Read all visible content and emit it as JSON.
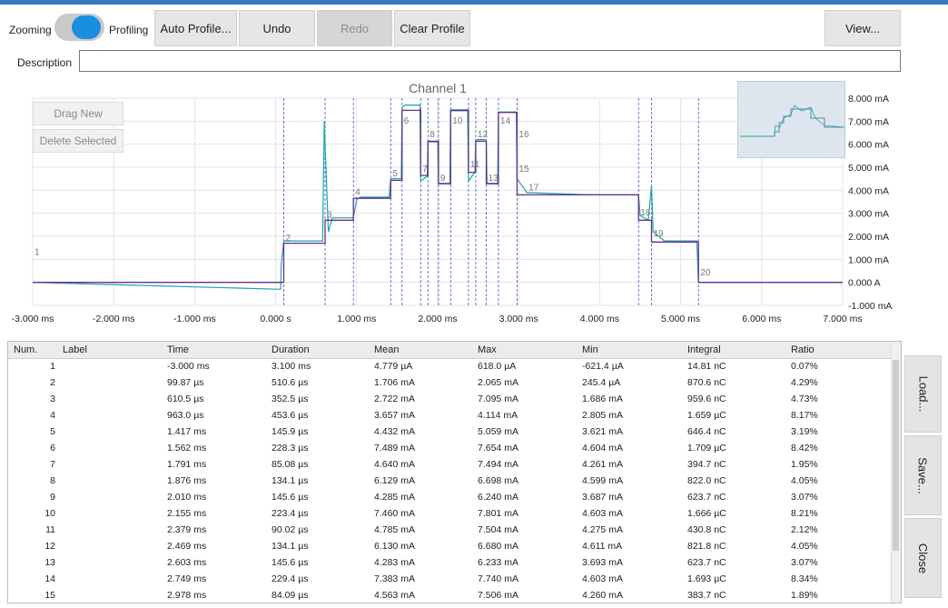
{
  "toolbar": {
    "zooming_label": "Zooming",
    "profiling_label": "Profiling",
    "auto_profile": "Auto Profile...",
    "undo": "Undo",
    "redo": "Redo",
    "clear_profile": "Clear Profile",
    "view": "View..."
  },
  "description": {
    "label": "Description",
    "value": ""
  },
  "chart_buttons": {
    "drag_new": "Drag New",
    "delete_selected": "Delete Selected"
  },
  "chart_data": {
    "type": "line",
    "title": "Channel 1",
    "x_unit": "ms",
    "xlim": [
      -3.0,
      7.0
    ],
    "ylim": [
      -1.0,
      8.0
    ],
    "x_ticks": [
      "-3.000 ms",
      "-2.000 ms",
      "-1.000 ms",
      "0.000 s",
      "1.000 ms",
      "2.000 ms",
      "3.000 ms",
      "4.000 ms",
      "5.000 ms",
      "6.000 ms",
      "7.000 ms"
    ],
    "y_ticks": [
      "8.000 mA",
      "7.000 mA",
      "6.000 mA",
      "5.000 mA",
      "4.000 mA",
      "3.000 mA",
      "2.000 mA",
      "1.000 mA",
      "0.000 A",
      "-1.000 mA"
    ],
    "grid": true,
    "series": [
      {
        "color": "#1aa6a6",
        "x": [
          -3.0,
          0.06,
          0.07,
          0.1,
          0.58,
          0.6,
          0.65,
          0.7,
          0.96,
          1.0,
          1.05,
          1.4,
          1.42,
          1.55,
          1.56,
          1.6,
          1.78,
          1.79,
          1.87,
          1.88,
          2.0,
          2.01,
          2.15,
          2.16,
          2.37,
          2.38,
          2.46,
          2.47,
          2.6,
          2.61,
          2.74,
          2.75,
          2.97,
          2.98,
          3.1,
          3.9,
          4.48,
          4.5,
          4.6,
          4.64,
          4.66,
          4.8,
          5.2,
          5.22,
          7.0
        ],
        "y": [
          0.0,
          -0.3,
          0.8,
          1.8,
          1.8,
          7.0,
          2.2,
          2.8,
          2.8,
          3.6,
          3.7,
          3.7,
          4.5,
          4.5,
          7.6,
          7.7,
          7.7,
          4.4,
          4.6,
          6.1,
          6.1,
          4.3,
          4.3,
          7.5,
          7.5,
          4.4,
          4.8,
          6.2,
          6.2,
          4.3,
          4.3,
          7.4,
          7.4,
          4.5,
          3.9,
          3.8,
          3.8,
          2.9,
          2.7,
          4.2,
          2.2,
          1.8,
          1.8,
          0.0,
          0.0
        ]
      },
      {
        "color": "#6a2d8c",
        "x": [
          -3.0,
          0.1,
          0.1,
          0.61,
          0.61,
          0.96,
          0.96,
          1.42,
          1.42,
          1.56,
          1.56,
          1.79,
          1.79,
          1.88,
          1.88,
          2.01,
          2.01,
          2.16,
          2.16,
          2.38,
          2.38,
          2.47,
          2.47,
          2.6,
          2.6,
          2.75,
          2.75,
          2.98,
          2.98,
          4.48,
          4.48,
          4.64,
          4.64,
          5.22,
          5.22,
          7.0
        ],
        "y": [
          0.0,
          0.0,
          1.7,
          1.7,
          2.7,
          2.7,
          3.65,
          3.65,
          4.43,
          4.43,
          7.47,
          7.47,
          4.64,
          4.64,
          6.13,
          6.13,
          4.28,
          4.28,
          7.46,
          7.46,
          4.78,
          4.78,
          6.13,
          6.13,
          4.28,
          4.28,
          7.38,
          7.38,
          3.8,
          3.8,
          2.7,
          2.7,
          1.75,
          1.75,
          0.0,
          0.0
        ]
      }
    ],
    "segment_markers": [
      {
        "n": "1",
        "x": -3.0,
        "y": 1.2
      },
      {
        "n": "2",
        "x": 0.1,
        "y": 1.8
      },
      {
        "n": "3",
        "x": 0.61,
        "y": 2.8
      },
      {
        "n": "4",
        "x": 0.96,
        "y": 3.8
      },
      {
        "n": "5",
        "x": 1.42,
        "y": 4.6
      },
      {
        "n": "6",
        "x": 1.56,
        "y": 6.9
      },
      {
        "n": "7",
        "x": 1.79,
        "y": 4.8
      },
      {
        "n": "8",
        "x": 1.88,
        "y": 6.3
      },
      {
        "n": "9",
        "x": 2.01,
        "y": 4.4
      },
      {
        "n": "10",
        "x": 2.16,
        "y": 6.9
      },
      {
        "n": "11",
        "x": 2.38,
        "y": 5.0
      },
      {
        "n": "12",
        "x": 2.47,
        "y": 6.3
      },
      {
        "n": "13",
        "x": 2.6,
        "y": 4.4
      },
      {
        "n": "14",
        "x": 2.75,
        "y": 6.9
      },
      {
        "n": "15",
        "x": 2.98,
        "y": 4.8
      },
      {
        "n": "16",
        "x": 2.98,
        "y": 6.3
      },
      {
        "n": "17",
        "x": 3.1,
        "y": 4.0
      },
      {
        "n": "18",
        "x": 4.48,
        "y": 2.9
      },
      {
        "n": "19",
        "x": 4.64,
        "y": 2.0
      },
      {
        "n": "20",
        "x": 5.22,
        "y": 0.3
      }
    ],
    "dividers": [
      0.1,
      0.61,
      0.96,
      1.42,
      1.56,
      1.79,
      1.88,
      2.01,
      2.16,
      2.38,
      2.47,
      2.6,
      2.75,
      2.98,
      4.48,
      4.64,
      5.22
    ]
  },
  "table": {
    "columns": [
      "Num.",
      "Label",
      "Time",
      "Duration",
      "Mean",
      "Max",
      "Min",
      "Integral",
      "Ratio"
    ],
    "rows": [
      [
        "1",
        "",
        "-3.000 ms",
        "3.100 ms",
        "4.779 µA",
        "618.0 µA",
        "-621.4 µA",
        "14.81 nC",
        "0.07%"
      ],
      [
        "2",
        "",
        "99.87 µs",
        "510.6 µs",
        "1.706 mA",
        "2.065 mA",
        "245.4 µA",
        "870.6 nC",
        "4.29%"
      ],
      [
        "3",
        "",
        "610.5 µs",
        "352.5 µs",
        "2.722 mA",
        "7.095 mA",
        "1.686 mA",
        "959.6 nC",
        "4.73%"
      ],
      [
        "4",
        "",
        "963.0 µs",
        "453.6 µs",
        "3.657 mA",
        "4.114 mA",
        "2.805 mA",
        "1.659 µC",
        "8.17%"
      ],
      [
        "5",
        "",
        "1.417 ms",
        "145.9 µs",
        "4.432 mA",
        "5.059 mA",
        "3.621 mA",
        "646.4 nC",
        "3.19%"
      ],
      [
        "6",
        "",
        "1.562 ms",
        "228.3 µs",
        "7.489 mA",
        "7.654 mA",
        "4.604 mA",
        "1.709 µC",
        "8.42%"
      ],
      [
        "7",
        "",
        "1.791 ms",
        "85.08 µs",
        "4.640 mA",
        "7.494 mA",
        "4.261 mA",
        "394.7 nC",
        "1.95%"
      ],
      [
        "8",
        "",
        "1.876 ms",
        "134.1 µs",
        "6.129 mA",
        "6.698 mA",
        "4.599 mA",
        "822.0 nC",
        "4.05%"
      ],
      [
        "9",
        "",
        "2.010 ms",
        "145.6 µs",
        "4.285 mA",
        "6.240 mA",
        "3.687 mA",
        "623.7 nC",
        "3.07%"
      ],
      [
        "10",
        "",
        "2.155 ms",
        "223.4 µs",
        "7.460 mA",
        "7.801 mA",
        "4.603 mA",
        "1.666 µC",
        "8.21%"
      ],
      [
        "11",
        "",
        "2.379 ms",
        "90.02 µs",
        "4.785 mA",
        "7.504 mA",
        "4.275 mA",
        "430.8 nC",
        "2.12%"
      ],
      [
        "12",
        "",
        "2.469 ms",
        "134.1 µs",
        "6.130 mA",
        "6.680 mA",
        "4.611 mA",
        "821.8 nC",
        "4.05%"
      ],
      [
        "13",
        "",
        "2.603 ms",
        "145.6 µs",
        "4.283 mA",
        "6.233 mA",
        "3.693 mA",
        "623.7 nC",
        "3.07%"
      ],
      [
        "14",
        "",
        "2.749 ms",
        "229.4 µs",
        "7.383 mA",
        "7.740 mA",
        "4.603 mA",
        "1.693 µC",
        "8.34%"
      ],
      [
        "15",
        "",
        "2.978 ms",
        "84.09 µs",
        "4.563 mA",
        "7.506 mA",
        "4.260 mA",
        "383.7 nC",
        "1.89%"
      ]
    ]
  },
  "side_buttons": {
    "load": "Load...",
    "save": "Save...",
    "close": "Close"
  }
}
